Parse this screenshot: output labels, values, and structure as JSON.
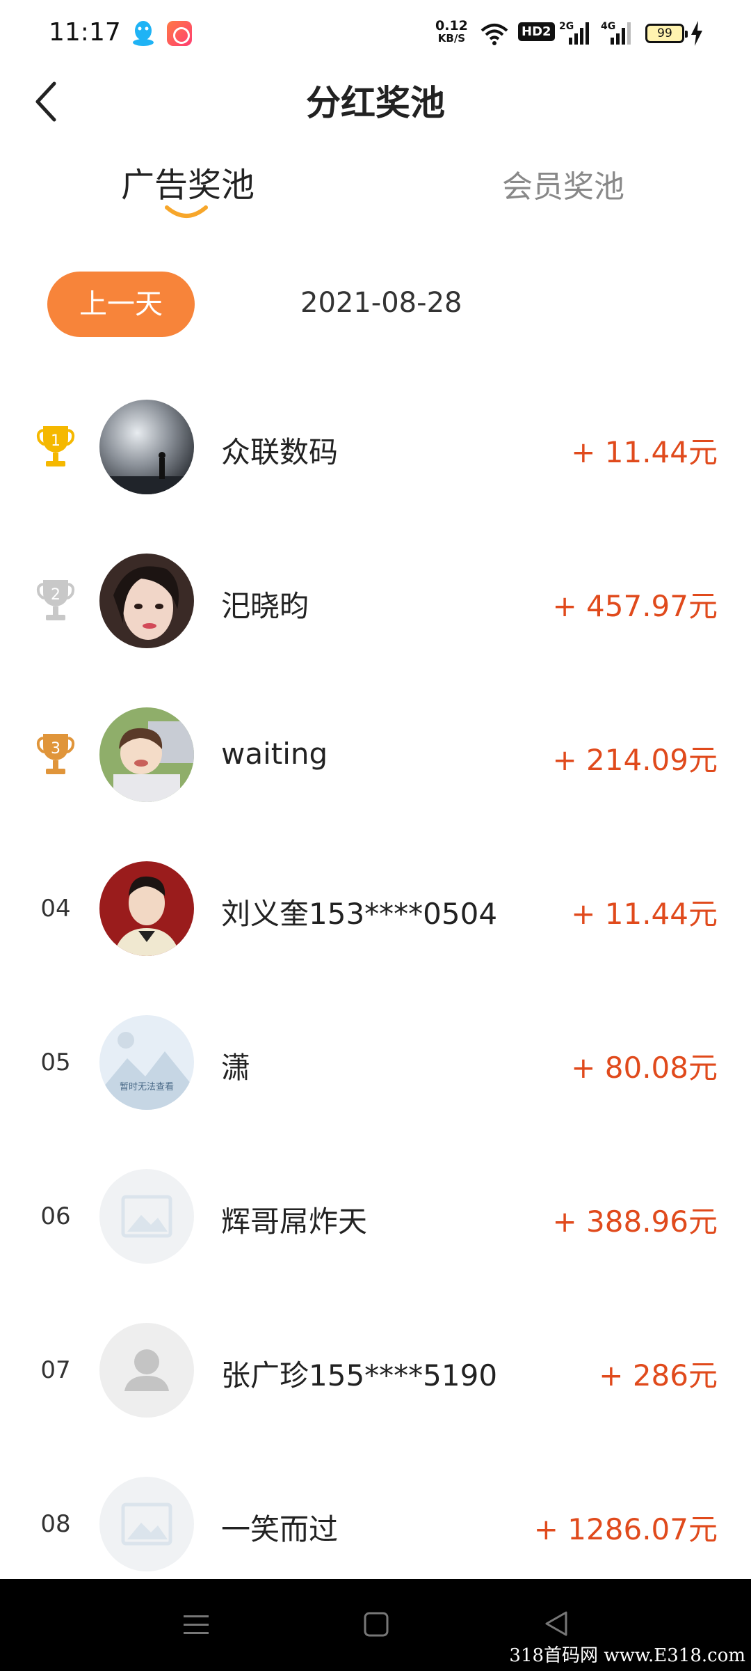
{
  "status_bar": {
    "time": "11:17",
    "net_speed_value": "0.12",
    "net_speed_unit": "KB/S",
    "hd_badge": "HD2",
    "signal_1_label": "2G",
    "signal_2_label": "4G",
    "battery": "99"
  },
  "header": {
    "title": "分红奖池"
  },
  "tabs": [
    {
      "label": "广告奖池",
      "active": true
    },
    {
      "label": "会员奖池",
      "active": false
    }
  ],
  "date_row": {
    "prev_day_label": "上一天",
    "date": "2021-08-28"
  },
  "ranking": [
    {
      "rank": "1",
      "name": "众联数码",
      "amount": "+ 11.44元",
      "trophy": "gold"
    },
    {
      "rank": "2",
      "name": "汜晓昀",
      "amount": "+ 457.97元",
      "trophy": "silver"
    },
    {
      "rank": "3",
      "name": "waiting",
      "amount": "+ 214.09元",
      "trophy": "bronze"
    },
    {
      "rank": "04",
      "name": "刘义奎153****0504",
      "amount": "+ 11.44元"
    },
    {
      "rank": "05",
      "name": "潇",
      "amount": "+ 80.08元"
    },
    {
      "rank": "06",
      "name": "辉哥屌炸天",
      "amount": "+ 388.96元"
    },
    {
      "rank": "07",
      "name": "张广珍155****5190",
      "amount": "+ 286元"
    },
    {
      "rank": "08",
      "name": "一笑而过",
      "amount": "+ 1286.07元"
    }
  ],
  "avatar_placeholder_text": "暂时无法查看",
  "watermark": "318首码网 www.E318.com",
  "colors": {
    "accent": "#f7843a",
    "amount": "#e04a1c",
    "gold": "#f5b800",
    "silver": "#c8c8c8",
    "bronze": "#e0953a"
  }
}
